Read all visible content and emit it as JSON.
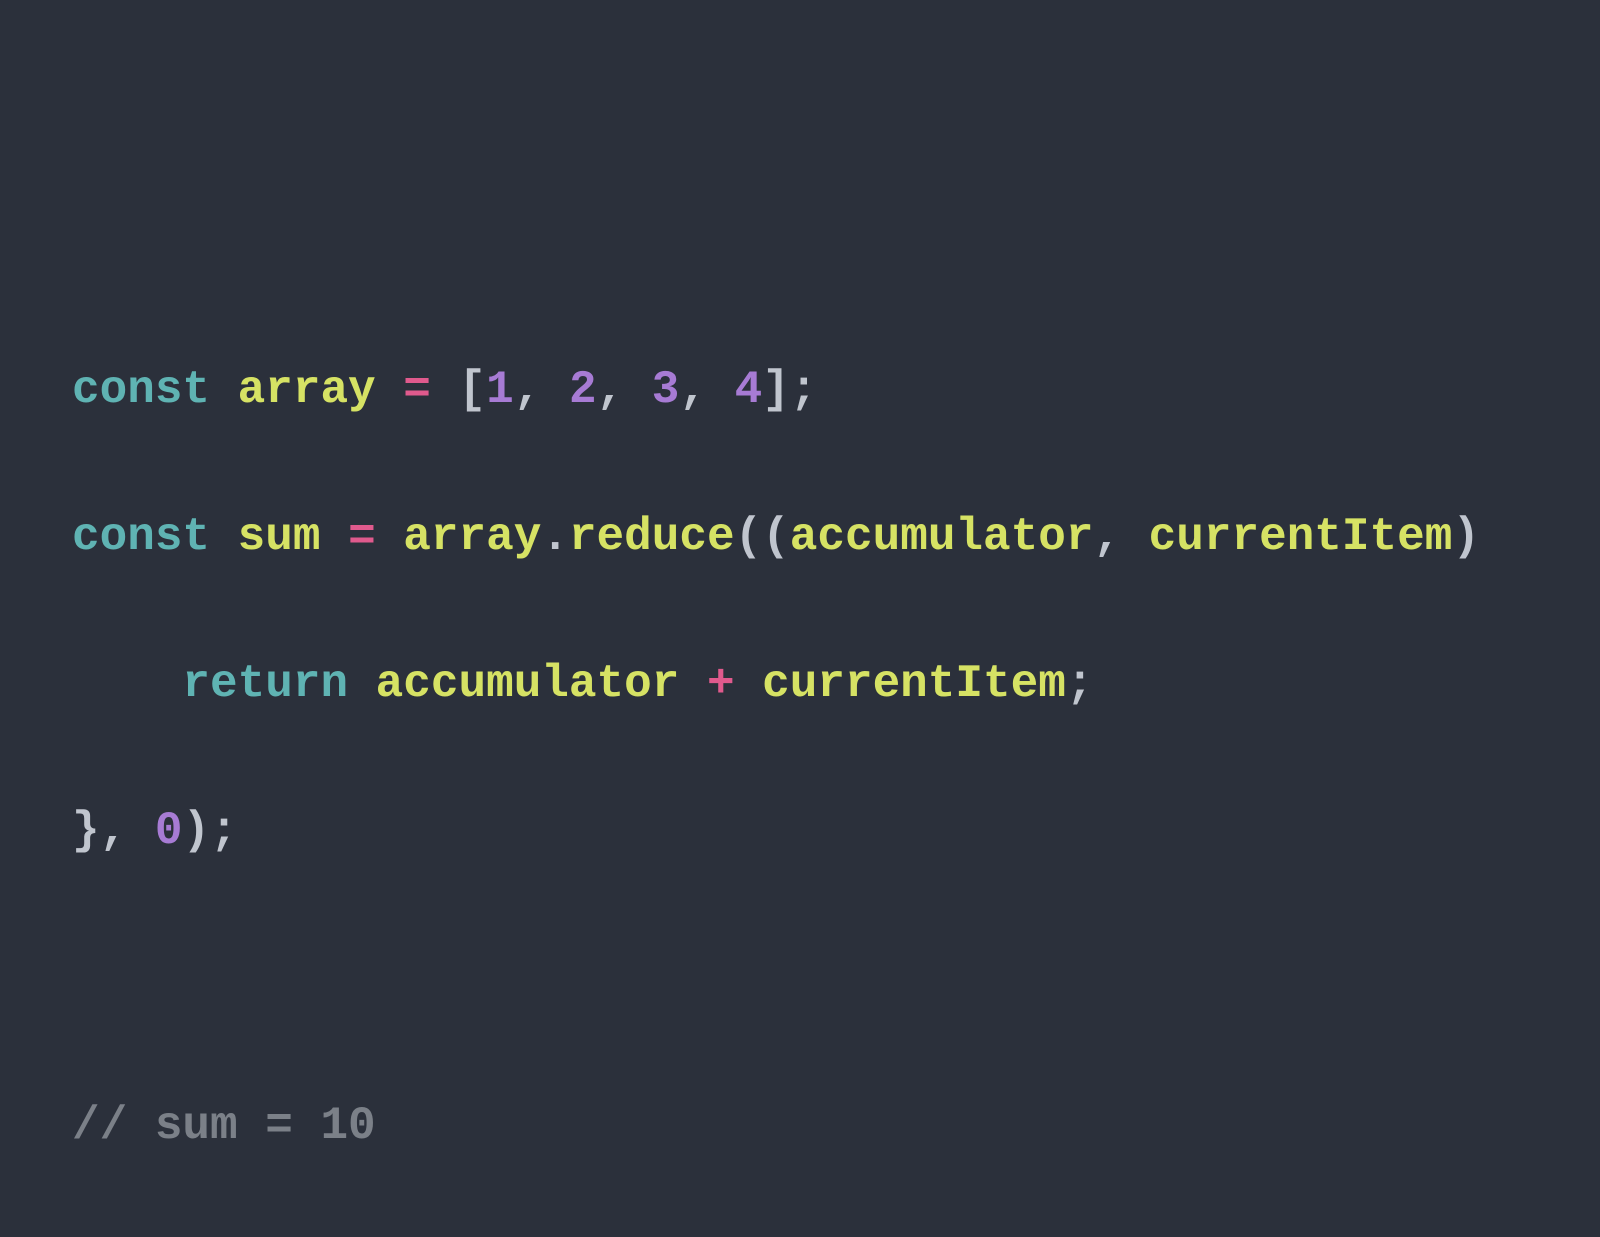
{
  "code": {
    "line1": {
      "kw": "const",
      "sp1": " ",
      "name": "array",
      "sp2": " ",
      "eq": "=",
      "sp3": " ",
      "lb": "[",
      "n1": "1",
      "c1": ", ",
      "n2": "2",
      "c2": ", ",
      "n3": "3",
      "c3": ", ",
      "n4": "4",
      "rb": "];"
    },
    "line2": {
      "kw": "const",
      "sp1": " ",
      "name": "sum",
      "sp2": " ",
      "eq": "=",
      "sp3": " ",
      "obj": "array",
      "dot": ".",
      "method": "reduce",
      "open": "((",
      "p1": "accumulator",
      "comma": ", ",
      "p2": "currentItem",
      "close": ") "
    },
    "line3": {
      "indent": "    ",
      "ret": "return",
      "sp": " ",
      "a": "accumulator",
      "sp2": " ",
      "plus": "+",
      "sp3": " ",
      "b": "currentItem",
      "semi": ";"
    },
    "line4": {
      "close": "}, ",
      "zero": "0",
      "end": ");"
    },
    "line6": {
      "comment": "// sum = 10"
    }
  }
}
